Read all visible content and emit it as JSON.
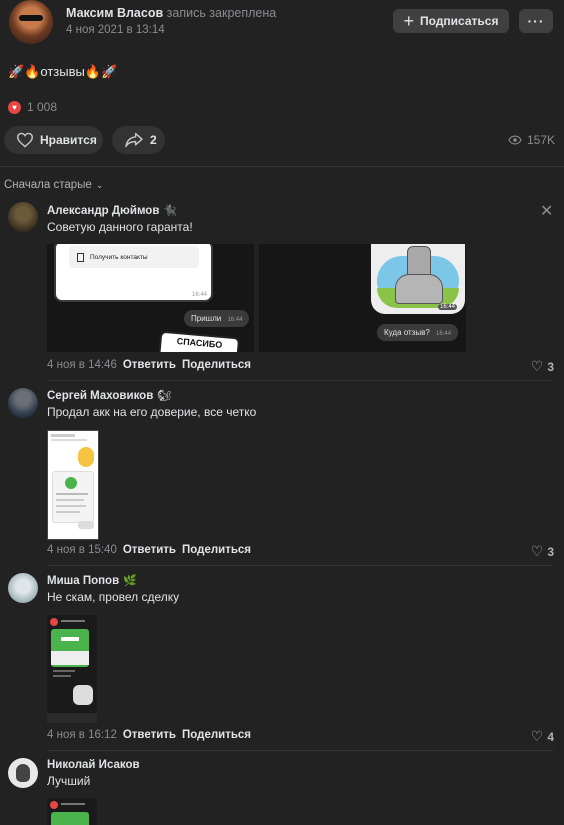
{
  "post": {
    "author": "Максим Власов",
    "pinned_note": "запись закреплена",
    "date": "4 ноя 2021 в 13:14",
    "subscribe_label": "Подписаться",
    "more_label": "···",
    "text": "🚀🔥отзывы🔥🚀",
    "reactions_count": "1 008",
    "like_label": "Нравится",
    "share_count": "2",
    "views": "157K"
  },
  "sort": {
    "label": "Сначала старые"
  },
  "comments": [
    {
      "author": "Александр Дюймов",
      "text": "Советую данного гаранта!",
      "time": "4 ноя в 14:46",
      "reply": "Ответить",
      "share": "Поделиться",
      "likes": "3",
      "img1": {
        "button": "Получить контакты",
        "time_a": "16:44",
        "bubble": "Пришли",
        "time_b": "16:44",
        "sticker": "СПАСИБО"
      },
      "img2": {
        "time_a": "16:44",
        "bubble": "Куда отзыв?",
        "time_b": "16:44"
      }
    },
    {
      "author": "Сергей Маховиков",
      "text": "Продал акк на его доверие, все четко",
      "time": "4 ноя в 15:40",
      "reply": "Ответить",
      "share": "Поделиться",
      "likes": "3"
    },
    {
      "author": "Миша Попов",
      "text": "Не скам, провел сделку",
      "time": "4 ноя в 16:12",
      "reply": "Ответить",
      "share": "Поделиться",
      "likes": "4"
    },
    {
      "author": "Николай Исаков",
      "text": "Лучший"
    }
  ],
  "colors": {
    "background": "#222222",
    "heart": "#e64646",
    "green": "#4bb34b",
    "button": "#404040"
  }
}
